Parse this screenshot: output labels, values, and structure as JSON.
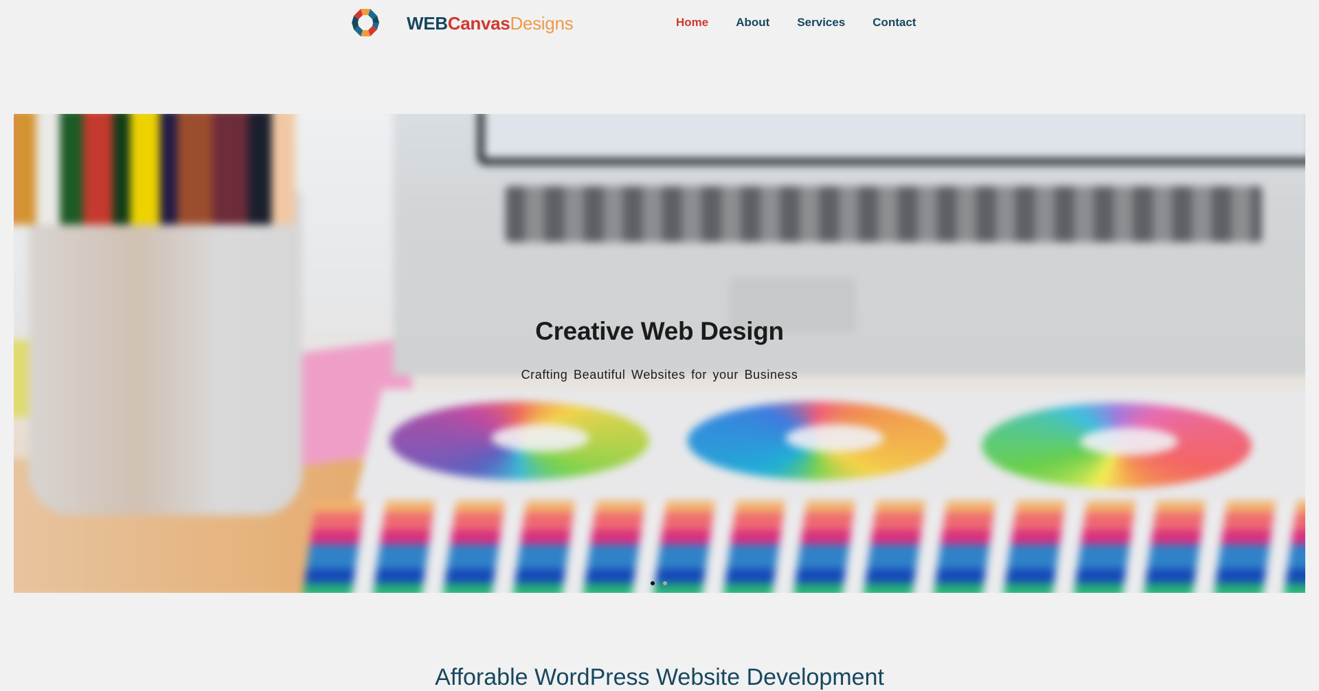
{
  "brand": {
    "part1": "WEB",
    "part2": "Canvas",
    "part3": "Designs",
    "colors": {
      "navy": "#17475f",
      "red": "#d0392e",
      "orange": "#ee9a49"
    }
  },
  "nav": {
    "items": [
      {
        "label": "Home",
        "active": true
      },
      {
        "label": "About",
        "active": false
      },
      {
        "label": "Services",
        "active": false
      },
      {
        "label": "Contact",
        "active": false
      }
    ]
  },
  "hero": {
    "title": "Creative Web Design",
    "subtitle": "Crafting Beautiful Websites for your Business",
    "slider": {
      "slides": 2,
      "active_index": 0
    }
  },
  "section": {
    "title": "Afforable WordPress Website Development"
  }
}
